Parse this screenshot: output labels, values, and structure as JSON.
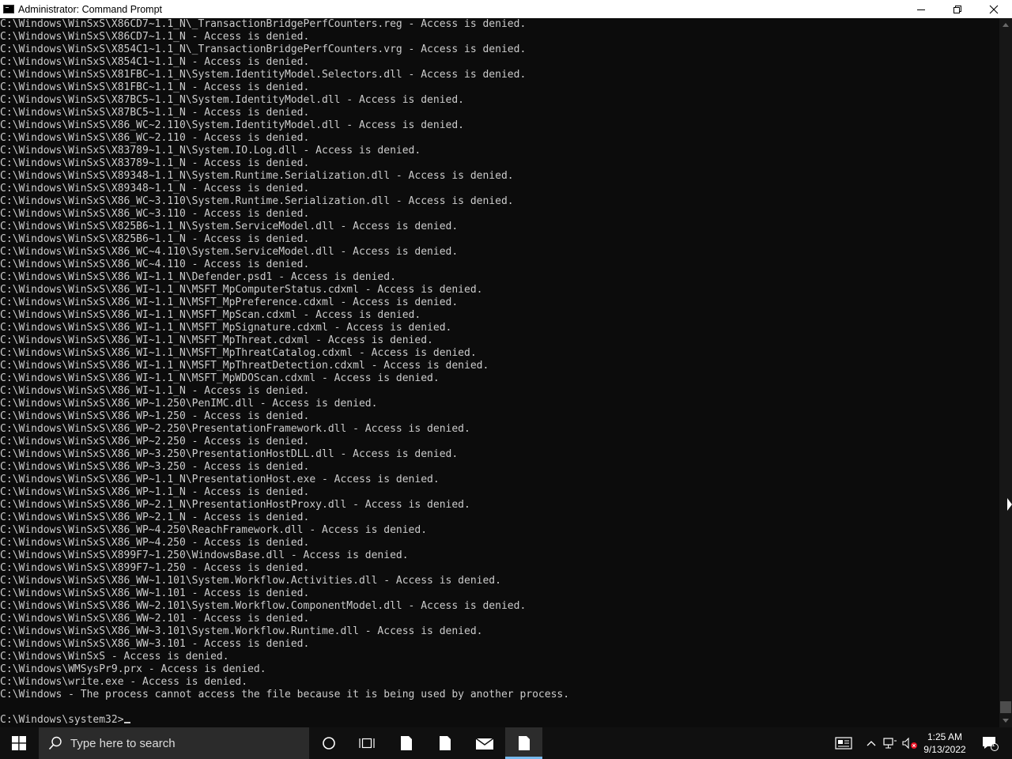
{
  "window": {
    "title": "Administrator: Command Prompt"
  },
  "console": {
    "lines": [
      "C:\\Windows\\WinSxS\\X86CD7~1.1_N\\_TransactionBridgePerfCounters.reg - Access is denied.",
      "C:\\Windows\\WinSxS\\X86CD7~1.1_N - Access is denied.",
      "C:\\Windows\\WinSxS\\X854C1~1.1_N\\_TransactionBridgePerfCounters.vrg - Access is denied.",
      "C:\\Windows\\WinSxS\\X854C1~1.1_N - Access is denied.",
      "C:\\Windows\\WinSxS\\X81FBC~1.1_N\\System.IdentityModel.Selectors.dll - Access is denied.",
      "C:\\Windows\\WinSxS\\X81FBC~1.1_N - Access is denied.",
      "C:\\Windows\\WinSxS\\X87BC5~1.1_N\\System.IdentityModel.dll - Access is denied.",
      "C:\\Windows\\WinSxS\\X87BC5~1.1_N - Access is denied.",
      "C:\\Windows\\WinSxS\\X86_WC~2.110\\System.IdentityModel.dll - Access is denied.",
      "C:\\Windows\\WinSxS\\X86_WC~2.110 - Access is denied.",
      "C:\\Windows\\WinSxS\\X83789~1.1_N\\System.IO.Log.dll - Access is denied.",
      "C:\\Windows\\WinSxS\\X83789~1.1_N - Access is denied.",
      "C:\\Windows\\WinSxS\\X89348~1.1_N\\System.Runtime.Serialization.dll - Access is denied.",
      "C:\\Windows\\WinSxS\\X89348~1.1_N - Access is denied.",
      "C:\\Windows\\WinSxS\\X86_WC~3.110\\System.Runtime.Serialization.dll - Access is denied.",
      "C:\\Windows\\WinSxS\\X86_WC~3.110 - Access is denied.",
      "C:\\Windows\\WinSxS\\X825B6~1.1_N\\System.ServiceModel.dll - Access is denied.",
      "C:\\Windows\\WinSxS\\X825B6~1.1_N - Access is denied.",
      "C:\\Windows\\WinSxS\\X86_WC~4.110\\System.ServiceModel.dll - Access is denied.",
      "C:\\Windows\\WinSxS\\X86_WC~4.110 - Access is denied.",
      "C:\\Windows\\WinSxS\\X86_WI~1.1_N\\Defender.psd1 - Access is denied.",
      "C:\\Windows\\WinSxS\\X86_WI~1.1_N\\MSFT_MpComputerStatus.cdxml - Access is denied.",
      "C:\\Windows\\WinSxS\\X86_WI~1.1_N\\MSFT_MpPreference.cdxml - Access is denied.",
      "C:\\Windows\\WinSxS\\X86_WI~1.1_N\\MSFT_MpScan.cdxml - Access is denied.",
      "C:\\Windows\\WinSxS\\X86_WI~1.1_N\\MSFT_MpSignature.cdxml - Access is denied.",
      "C:\\Windows\\WinSxS\\X86_WI~1.1_N\\MSFT_MpThreat.cdxml - Access is denied.",
      "C:\\Windows\\WinSxS\\X86_WI~1.1_N\\MSFT_MpThreatCatalog.cdxml - Access is denied.",
      "C:\\Windows\\WinSxS\\X86_WI~1.1_N\\MSFT_MpThreatDetection.cdxml - Access is denied.",
      "C:\\Windows\\WinSxS\\X86_WI~1.1_N\\MSFT_MpWDOScan.cdxml - Access is denied.",
      "C:\\Windows\\WinSxS\\X86_WI~1.1_N - Access is denied.",
      "C:\\Windows\\WinSxS\\X86_WP~1.250\\PenIMC.dll - Access is denied.",
      "C:\\Windows\\WinSxS\\X86_WP~1.250 - Access is denied.",
      "C:\\Windows\\WinSxS\\X86_WP~2.250\\PresentationFramework.dll - Access is denied.",
      "C:\\Windows\\WinSxS\\X86_WP~2.250 - Access is denied.",
      "C:\\Windows\\WinSxS\\X86_WP~3.250\\PresentationHostDLL.dll - Access is denied.",
      "C:\\Windows\\WinSxS\\X86_WP~3.250 - Access is denied.",
      "C:\\Windows\\WinSxS\\X86_WP~1.1_N\\PresentationHost.exe - Access is denied.",
      "C:\\Windows\\WinSxS\\X86_WP~1.1_N - Access is denied.",
      "C:\\Windows\\WinSxS\\X86_WP~2.1_N\\PresentationHostProxy.dll - Access is denied.",
      "C:\\Windows\\WinSxS\\X86_WP~2.1_N - Access is denied.",
      "C:\\Windows\\WinSxS\\X86_WP~4.250\\ReachFramework.dll - Access is denied.",
      "C:\\Windows\\WinSxS\\X86_WP~4.250 - Access is denied.",
      "C:\\Windows\\WinSxS\\X899F7~1.250\\WindowsBase.dll - Access is denied.",
      "C:\\Windows\\WinSxS\\X899F7~1.250 - Access is denied.",
      "C:\\Windows\\WinSxS\\X86_WW~1.101\\System.Workflow.Activities.dll - Access is denied.",
      "C:\\Windows\\WinSxS\\X86_WW~1.101 - Access is denied.",
      "C:\\Windows\\WinSxS\\X86_WW~2.101\\System.Workflow.ComponentModel.dll - Access is denied.",
      "C:\\Windows\\WinSxS\\X86_WW~2.101 - Access is denied.",
      "C:\\Windows\\WinSxS\\X86_WW~3.101\\System.Workflow.Runtime.dll - Access is denied.",
      "C:\\Windows\\WinSxS\\X86_WW~3.101 - Access is denied.",
      "C:\\Windows\\WinSxS - Access is denied.",
      "C:\\Windows\\WMSysPr9.prx - Access is denied.",
      "C:\\Windows\\write.exe - Access is denied.",
      "C:\\Windows - The process cannot access the file because it is being used by another process.",
      ""
    ],
    "prompt": "C:\\Windows\\system32>"
  },
  "taskbar": {
    "search_placeholder": "Type here to search",
    "time": "1:25 AM",
    "date": "9/13/2022",
    "notification_count": "1"
  },
  "colors": {
    "console_bg": "#0c0c0c",
    "console_text": "#cccccc",
    "taskbar_bg": "#101010",
    "accent": "#76b9ed"
  }
}
